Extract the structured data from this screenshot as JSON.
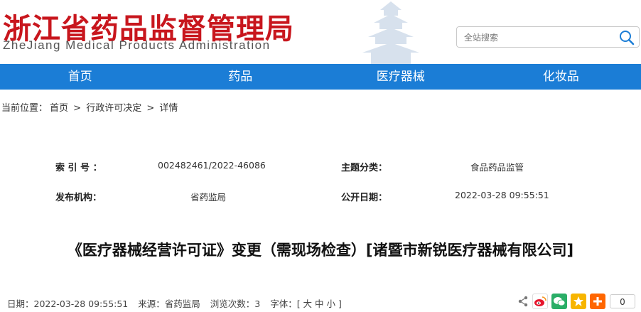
{
  "header": {
    "title_cn": "浙江省药品监督管理局",
    "title_en": "ZheJiang Medical Products Administration",
    "search_placeholder": "全站搜索"
  },
  "nav": [
    "首页",
    "药品",
    "医疗器械",
    "化妆品"
  ],
  "breadcrumb": {
    "prefix": "当前位置：",
    "items": [
      "首页",
      "行政许可决定",
      "详情"
    ],
    "separator": ">"
  },
  "info": {
    "index_label": "索 引 号 ：",
    "index_value": "002482461/2022-46086",
    "topic_label": "主题分类：",
    "topic_value": "食品药品监管",
    "org_label": "发布机构：",
    "org_value": "省药监局",
    "date_label": "公开日期：",
    "date_value": "2022-03-28 09:55:51"
  },
  "article": {
    "title": "《医疗器械经营许可证》变更（需现场检查）[诸暨市新锐医疗器械有限公司]"
  },
  "meta": {
    "date": "日期：2022-03-28 09:55:51",
    "source": "来源：省药监局",
    "views": "浏览次数：3",
    "font": "字体：[ 大 中 小 ]"
  },
  "share": {
    "count": "0",
    "colors": {
      "weibo": "#e6162d",
      "wechat": "#2aae67",
      "qzone": "#f7b500",
      "more": "#ff6600"
    }
  },
  "colors": {
    "brand_red": "#c8161d",
    "nav_blue": "#1b7dd6"
  }
}
